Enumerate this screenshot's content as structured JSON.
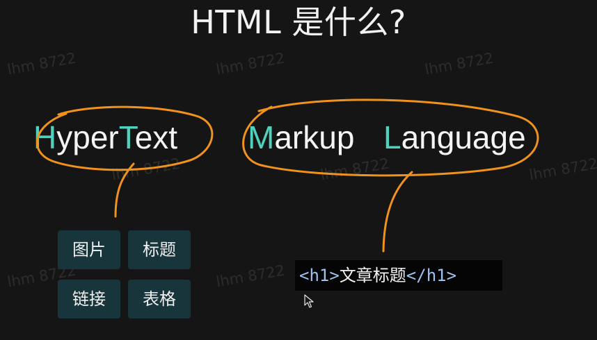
{
  "slide": {
    "title": "HTML 是什么?",
    "terms": [
      {
        "initial": "H",
        "rest": "yper"
      },
      {
        "initial": "T",
        "rest": "ext"
      },
      {
        "initial": "M",
        "rest": "arkup"
      },
      {
        "initial": "L",
        "rest": "anguage"
      }
    ],
    "hypertext_examples": [
      "图片",
      "标题",
      "链接",
      "表格"
    ],
    "code_example": {
      "open_tag": "<h1>",
      "content": "文章标题",
      "close_tag": "</h1>"
    },
    "watermark": "lhm 8722",
    "colors": {
      "background": "#151515",
      "highlight": "#4fd1bd",
      "annotation": "#f0921c",
      "button_bg": "#17353a",
      "code_tag": "#9ec2ee"
    },
    "icons": [
      "mouse-cursor-icon"
    ]
  }
}
